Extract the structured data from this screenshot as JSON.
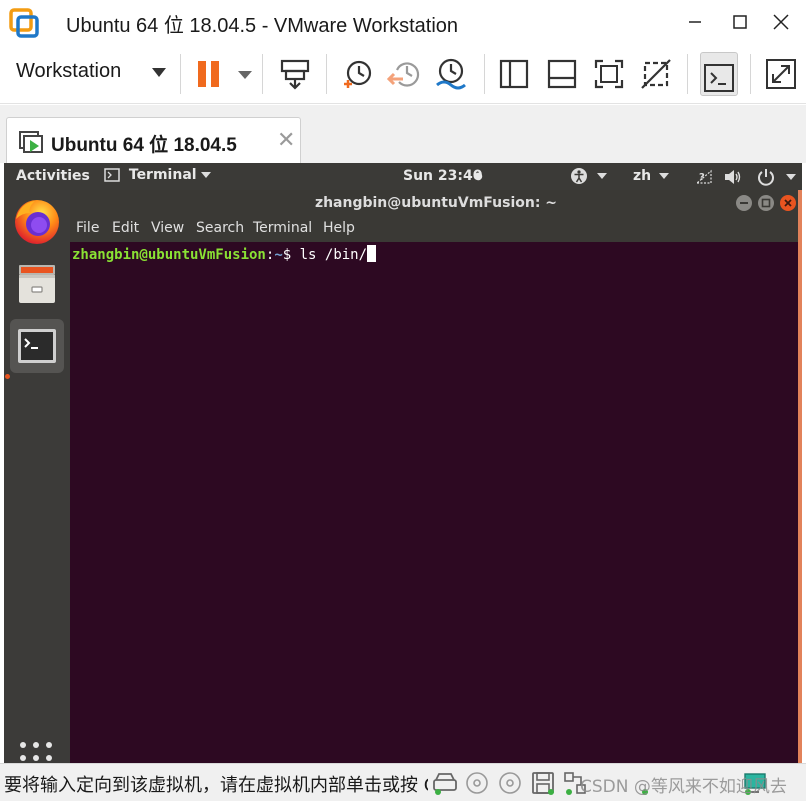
{
  "window": {
    "title": "Ubuntu 64 位 18.04.5 - VMware Workstation",
    "minimize": "—",
    "maximize": "☐",
    "close": "✕"
  },
  "toolbar": {
    "menu_label": "Workstation"
  },
  "tabs": [
    {
      "label": "Ubuntu 64 位 18.04.5",
      "close": "✕"
    }
  ],
  "ubuntu": {
    "activities": "Activities",
    "app_menu": "Terminal",
    "clock": "Sun 23:40",
    "clock_dot": "●",
    "input_method": "zh"
  },
  "terminal": {
    "title": "zhangbin@ubuntuVmFusion: ~",
    "menu": [
      "File",
      "Edit",
      "View",
      "Search",
      "Terminal",
      "Help"
    ],
    "prompt_user": "zhangbin@ubuntuVmFusion",
    "prompt_sep": ":",
    "prompt_path": "~",
    "prompt_symbol": "$ ",
    "command": "ls /bin/"
  },
  "statusbar": {
    "message": "要将输入定向到该虚拟机，请在虚拟机内部单击或按 Ctrl+G。",
    "watermark": "CSDN @等风来不如迎风去"
  },
  "colors": {
    "terminal_bg": "#2d0922",
    "prompt_user": "#8ae234",
    "prompt_path": "#729fcf",
    "accent": "#e95420"
  }
}
